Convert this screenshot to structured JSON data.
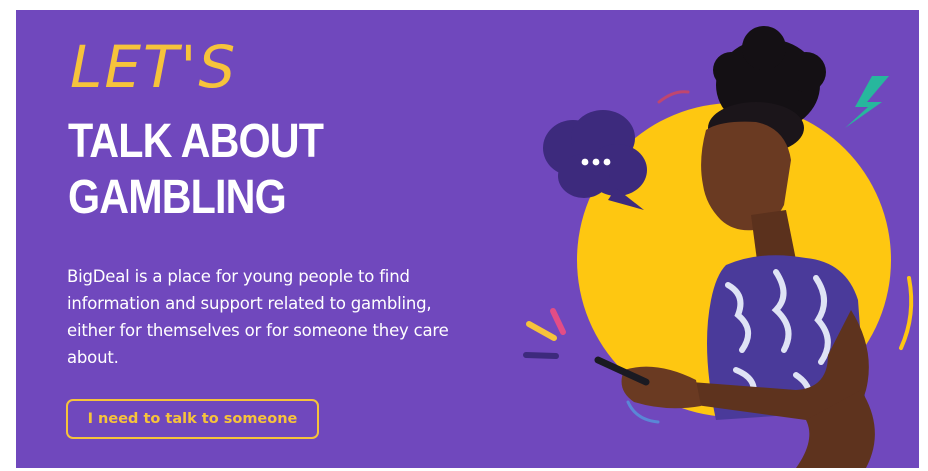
{
  "hero": {
    "eyebrow": "LET'S",
    "title_line1": "TALK ABOUT",
    "title_line2": "GAMBLING",
    "description": "BigDeal is a place for young people to find information and support related to gambling, either for themselves or for someone they care about.",
    "cta_label": "I need to talk to someone"
  },
  "colors": {
    "background": "#7048bd",
    "accent_yellow": "#f6c33b",
    "circle_yellow": "#fec711",
    "bubble": "#3d2a7d",
    "teal": "#27b79d",
    "pink": "#e34d86"
  },
  "icons": {
    "speech_bubble": "chat-bubble-icon",
    "bolt": "lightning-icon"
  }
}
